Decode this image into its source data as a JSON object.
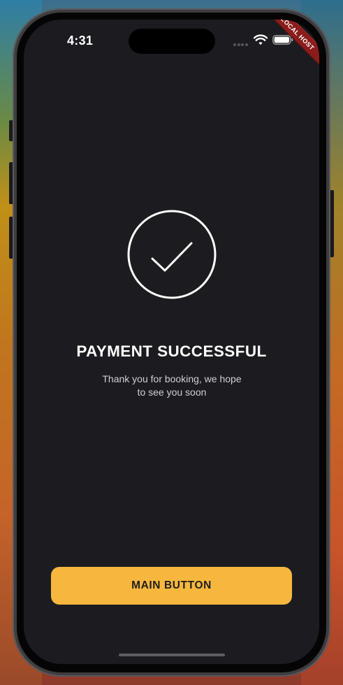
{
  "status_bar": {
    "time": "4:31",
    "icons": [
      "cellular-signal-icon",
      "wifi-icon",
      "battery-icon"
    ]
  },
  "debug_banner": {
    "label": "LOCAL HOST"
  },
  "success": {
    "icon": "checkmark-circle-icon",
    "title": "PAYMENT SUCCESSFUL",
    "message_line1": "Thank you for booking, we hope",
    "message_line2": "to see you soon"
  },
  "actions": {
    "main_button_label": "MAIN BUTTON"
  },
  "colors": {
    "screen_background": "#1c1c20",
    "accent": "#f7b73e",
    "title_text": "#ffffff",
    "subtitle_text": "#cfcfd4",
    "debug_banner": "#8b1c1c"
  }
}
